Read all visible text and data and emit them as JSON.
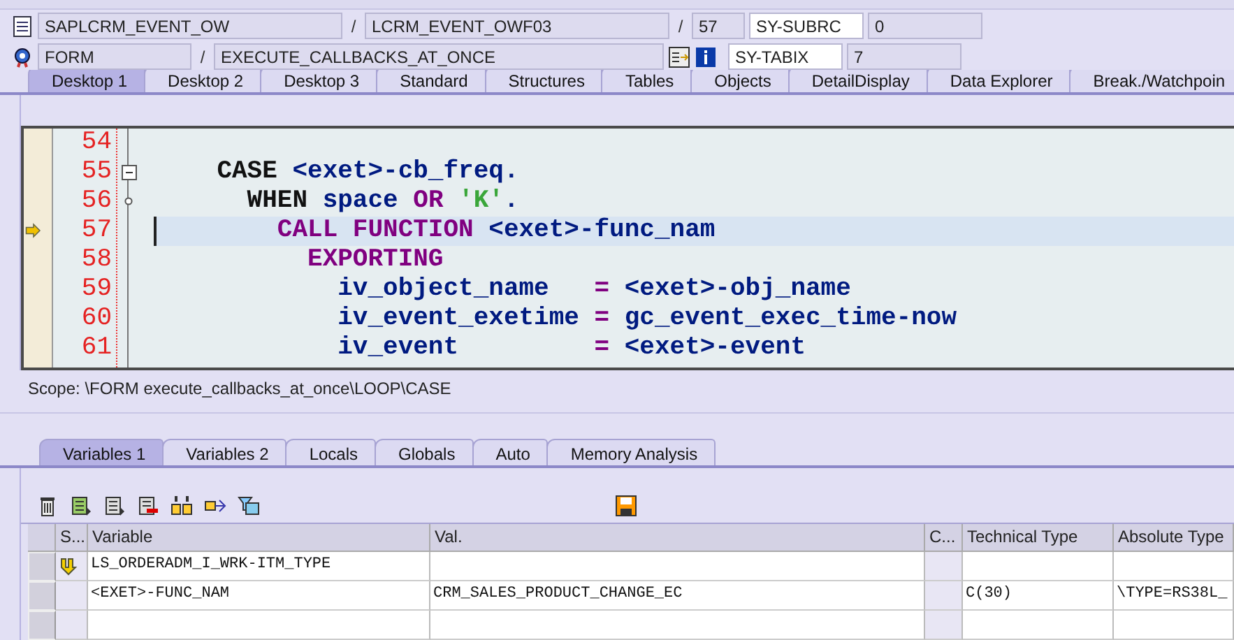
{
  "header": {
    "program": "SAPLCRM_EVENT_OW",
    "include": "LCRM_EVENT_OWF03",
    "line": "57",
    "event_type": "FORM",
    "event": "EXECUTE_CALLBACKS_AT_ONCE",
    "sysvars": [
      {
        "name": "SY-SUBRC",
        "value": "0"
      },
      {
        "name": "SY-TABIX",
        "value": "7"
      }
    ],
    "separators": [
      "/",
      "/",
      "/"
    ]
  },
  "desktop_tabs": [
    {
      "label": "Desktop 1",
      "selected": true
    },
    {
      "label": "Desktop 2",
      "selected": false
    },
    {
      "label": "Desktop 3",
      "selected": false
    },
    {
      "label": "Standard",
      "selected": false
    },
    {
      "label": "Structures",
      "selected": false
    },
    {
      "label": "Tables",
      "selected": false
    },
    {
      "label": "Objects",
      "selected": false
    },
    {
      "label": "DetailDisplay",
      "selected": false
    },
    {
      "label": "Data Explorer",
      "selected": false
    },
    {
      "label": "Break./Watchpoin",
      "selected": false
    }
  ],
  "code": [
    {
      "number": "54",
      "current": false,
      "collapsible": false
    },
    {
      "number": "55",
      "current": false,
      "collapsible": true,
      "tokens": [
        {
          "kind": "keyword",
          "text": "    CASE "
        },
        {
          "kind": "ident",
          "text": "<exet>-cb_freq."
        }
      ]
    },
    {
      "number": "56",
      "current": false,
      "collapsible": false,
      "tokens": [
        {
          "kind": "keyword",
          "text": "      WHEN "
        },
        {
          "kind": "ident",
          "text": "space "
        },
        {
          "kind": "operator",
          "text": "OR "
        },
        {
          "kind": "string",
          "text": "'K'"
        },
        {
          "kind": "ident",
          "text": "."
        }
      ]
    },
    {
      "number": "57",
      "current": true,
      "collapsible": false,
      "tokens": [
        {
          "kind": "statement",
          "text": "        CALL FUNCTION "
        },
        {
          "kind": "ident",
          "text": "<exet>-func_nam"
        }
      ]
    },
    {
      "number": "58",
      "current": false,
      "collapsible": false,
      "tokens": [
        {
          "kind": "statement",
          "text": "          EXPORTING"
        }
      ]
    },
    {
      "number": "59",
      "current": false,
      "collapsible": false,
      "tokens": [
        {
          "kind": "ident",
          "text": "            iv_object_name   "
        },
        {
          "kind": "operator",
          "text": "= "
        },
        {
          "kind": "ident",
          "text": "<exet>-obj_name"
        }
      ]
    },
    {
      "number": "60",
      "current": false,
      "collapsible": false,
      "tokens": [
        {
          "kind": "ident",
          "text": "            iv_event_exetime "
        },
        {
          "kind": "operator",
          "text": "= "
        },
        {
          "kind": "ident",
          "text": "gc_event_exec_time-now"
        }
      ]
    },
    {
      "number": "61",
      "current": false,
      "collapsible": false,
      "tokens": [
        {
          "kind": "ident",
          "text": "            iv_event         "
        },
        {
          "kind": "operator",
          "text": "= "
        },
        {
          "kind": "ident",
          "text": "<exet>-event"
        }
      ]
    }
  ],
  "scope": "Scope: \\FORM execute_callbacks_at_once\\LOOP\\CASE",
  "variable_tabs": [
    {
      "label": "Variables 1",
      "selected": true
    },
    {
      "label": "Variables 2",
      "selected": false
    },
    {
      "label": "Locals",
      "selected": false
    },
    {
      "label": "Globals",
      "selected": false
    },
    {
      "label": "Auto",
      "selected": false
    },
    {
      "label": "Memory Analysis",
      "selected": false
    }
  ],
  "table": {
    "columns": [
      "S...",
      "Variable",
      "Val.",
      "C...",
      "Technical Type",
      "Absolute Type"
    ],
    "rows": [
      {
        "changed": true,
        "variable": "LS_ORDERADM_I_WRK-ITM_TYPE",
        "value": "",
        "c": "",
        "technical_type": "",
        "absolute_type": ""
      },
      {
        "changed": false,
        "variable": "<EXET>-FUNC_NAM",
        "value": "CRM_SALES_PRODUCT_CHANGE_EC",
        "c": "",
        "technical_type": "C(30)",
        "absolute_type": "\\TYPE=RS38L_"
      },
      {
        "changed": false,
        "variable": "",
        "value": "",
        "c": "",
        "technical_type": "",
        "absolute_type": ""
      }
    ]
  }
}
